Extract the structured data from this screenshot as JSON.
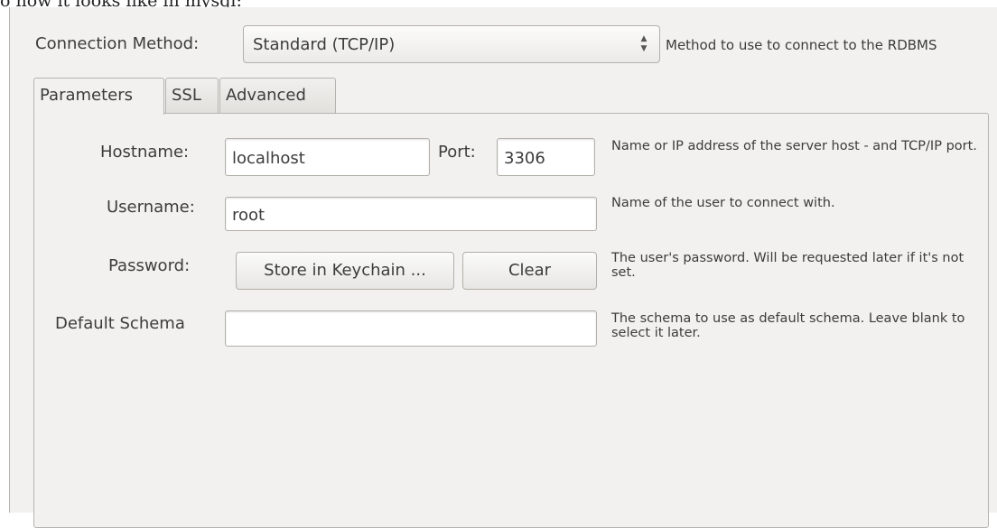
{
  "caption_fragment": "o how it looks like in mysql:",
  "connection": {
    "label": "Connection Method:",
    "selected": "Standard (TCP/IP)",
    "hint": "Method to use to connect to the RDBMS"
  },
  "tabs": [
    {
      "label": "Parameters",
      "active": true
    },
    {
      "label": "SSL",
      "active": false
    },
    {
      "label": "Advanced",
      "active": false
    }
  ],
  "hostname": {
    "label": "Hostname:",
    "value": "localhost",
    "port_label": "Port:",
    "port_value": "3306",
    "hint": "Name or IP address of the server host - and TCP/IP port."
  },
  "username": {
    "label": "Username:",
    "value": "root",
    "hint": "Name of the user to connect with."
  },
  "password": {
    "label": "Password:",
    "store_button": "Store in Keychain ...",
    "clear_button": "Clear",
    "hint": "The user's password. Will be requested later if it's not set."
  },
  "schema": {
    "label": "Default Schema",
    "value": "",
    "hint": "The schema to use as default schema. Leave blank to select it later."
  }
}
